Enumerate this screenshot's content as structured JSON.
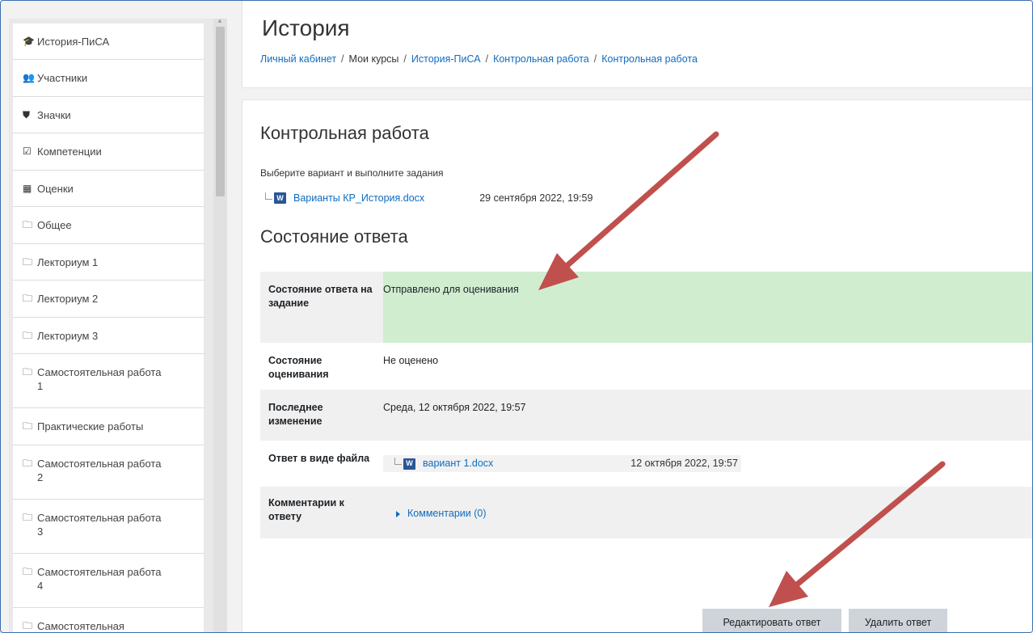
{
  "sidebar": {
    "items": [
      {
        "icon": "graduation-cap-icon",
        "glyph": "🎓",
        "label": "История-ПиСА"
      },
      {
        "icon": "users-icon",
        "glyph": "👥",
        "label": "Участники"
      },
      {
        "icon": "shield-icon",
        "glyph": "⛊",
        "label": "Значки"
      },
      {
        "icon": "checkbox-icon",
        "glyph": "☑",
        "label": "Компетенции"
      },
      {
        "icon": "table-icon",
        "glyph": "▦",
        "label": "Оценки"
      },
      {
        "icon": "folder-icon",
        "glyph": "🗀",
        "label": "Общее"
      },
      {
        "icon": "folder-icon",
        "glyph": "🗀",
        "label": "Лекториум 1"
      },
      {
        "icon": "folder-icon",
        "glyph": "🗀",
        "label": "Лекториум 2"
      },
      {
        "icon": "folder-icon",
        "glyph": "🗀",
        "label": "Лекториум 3"
      },
      {
        "icon": "folder-icon",
        "glyph": "🗀",
        "label": "Самостоятельная работа 1"
      },
      {
        "icon": "folder-icon",
        "glyph": "🗀",
        "label": "Практические работы"
      },
      {
        "icon": "folder-icon",
        "glyph": "🗀",
        "label": "Самостоятельная работа 2"
      },
      {
        "icon": "folder-icon",
        "glyph": "🗀",
        "label": "Самостоятельная работа 3"
      },
      {
        "icon": "folder-icon",
        "glyph": "🗀",
        "label": "Самостоятельная работа 4"
      },
      {
        "icon": "folder-icon",
        "glyph": "🗀",
        "label": "Самостоятельная"
      }
    ]
  },
  "header": {
    "title": "История",
    "breadcrumb": [
      "Личный кабинет",
      "Мои курсы",
      "История-ПиСА",
      "Контрольная работа",
      "Контрольная работа"
    ]
  },
  "assignment": {
    "title": "Контрольная работа",
    "description": "Выберите вариант и выполните задания",
    "attachment": {
      "name": "Варианты КР_История.docx",
      "date": "29 сентября 2022, 19:59"
    }
  },
  "submission": {
    "heading": "Состояние ответа",
    "rows": [
      {
        "label": "Состояние ответа на задание",
        "value": "Отправлено для оценивания"
      },
      {
        "label": "Состояние оценивания",
        "value": "Не оценено"
      },
      {
        "label": "Последнее изменение",
        "value": "Среда, 12 октября 2022, 19:57"
      },
      {
        "label": "Ответ в виде файла",
        "file_name": "вариант 1.docx",
        "file_date": "12 октября 2022, 19:57"
      },
      {
        "label": "Комментарии к ответу",
        "comments_link": "Комментарии (0)"
      }
    ]
  },
  "buttons": {
    "edit": "Редактировать ответ",
    "delete": "Удалить ответ"
  },
  "colors": {
    "link": "#0f6cbf",
    "status_submitted": "#d0edd0",
    "annotation_arrow": "#c0504d"
  }
}
